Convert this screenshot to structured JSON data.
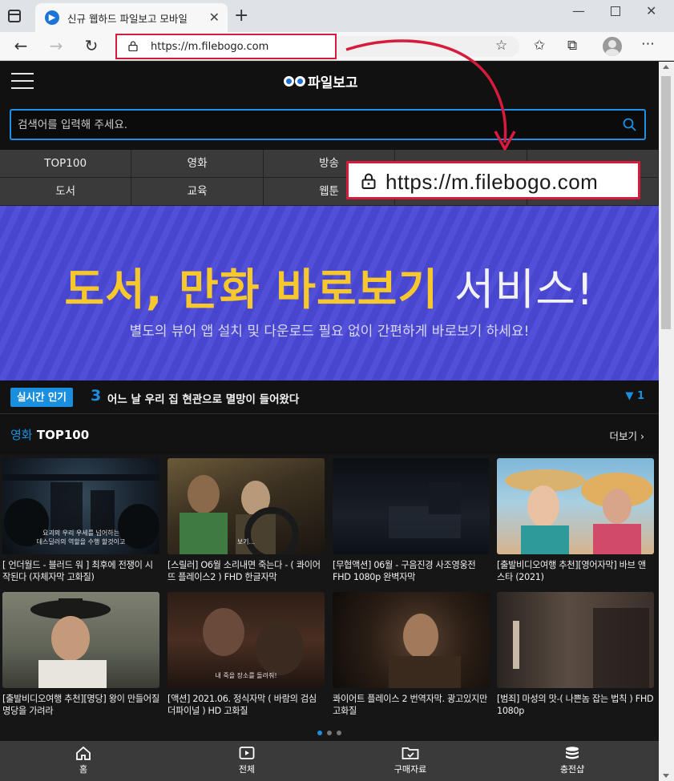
{
  "browser": {
    "tab_title": "신규 웹하드 파일보고 모바일",
    "url": "https://m.filebogo.com"
  },
  "site": {
    "logo_text": "파일보고",
    "search_placeholder": "검색어를 입력해 주세요.",
    "categories": [
      "TOP100",
      "영화",
      "방송",
      "",
      "",
      "도서",
      "교육",
      "웹툰",
      "",
      ""
    ],
    "callout_url": "https://m.filebogo.com",
    "banner": {
      "headline_yellow": "도서, 만화 바로보기",
      "headline_white": "서비스!",
      "subline": "별도의 뷰어 앱 설치 및 다운로드 필요 없이 간편하게 바로보기 하세요!"
    },
    "ticker": {
      "badge": "실시간 인기",
      "number": "3",
      "text": "어느 날 우리 집 현관으로 멸망이 들어왔다",
      "rank": "▼ 1"
    },
    "section": {
      "category": "영화",
      "title": "TOP100",
      "more": "더보기"
    },
    "cards": [
      {
        "caption": "[ 언더월드 - 블러드 워 ] 최후에 전쟁이 시작된다 (자체자막 고화질)",
        "subtitle": "요괴의 우리 우세를 넘어하는\n데스딜러의 역할을 수행 할것이고"
      },
      {
        "caption": "[스릴러] O6월 소리내면 죽는다 - ( 콰이어뜨 플레이스2 ) FHD 한글자막",
        "subtitle": "보기..."
      },
      {
        "caption": "[무협액션] 06월 - 구음진경 사조영웅전 FHD 1080p 완벽자막",
        "subtitle": ""
      },
      {
        "caption": "[출발비디오여행 추천][영어자막] 바브 앤 스타 (2021)",
        "subtitle": ""
      },
      {
        "caption": "[출발비디오여행 추천][명당] 왕이 만들어질 명당을 가려라",
        "subtitle": ""
      },
      {
        "caption": "[액션] 2021.06. 정식자막 ( 바람의 검심 더파이널 ) HD 고화질",
        "subtitle": "내 죽을 장소를 돌려줘!"
      },
      {
        "caption": "콰이어트 플레이스 2 번역자막. 광고있지만 고화질",
        "subtitle": ""
      },
      {
        "caption": "[범죄] 마성의 맛-( 나쁜놈 잡는 법칙 ) FHD 1080p",
        "subtitle": ""
      }
    ],
    "bottom_nav": [
      "홈",
      "전체",
      "구매자료",
      "충전샵"
    ]
  }
}
